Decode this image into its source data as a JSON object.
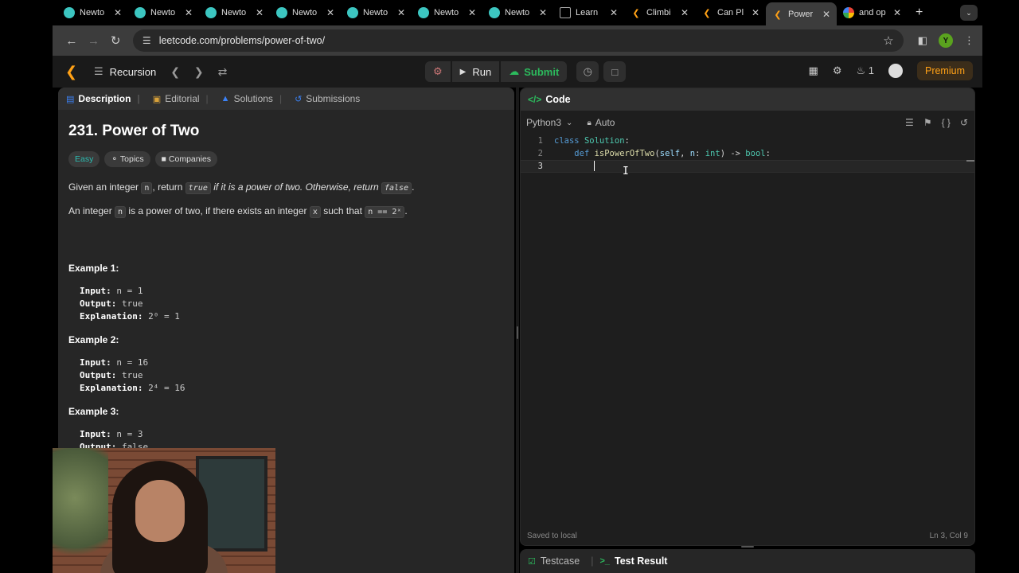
{
  "browser": {
    "tabs": [
      {
        "label": "Newto",
        "fav": "newton"
      },
      {
        "label": "Newto",
        "fav": "newton"
      },
      {
        "label": "Newto",
        "fav": "newton"
      },
      {
        "label": "Newto",
        "fav": "newton"
      },
      {
        "label": "Newto",
        "fav": "newton"
      },
      {
        "label": "Newto",
        "fav": "newton"
      },
      {
        "label": "Newto",
        "fav": "newton"
      },
      {
        "label": "Learn",
        "fav": "doc"
      },
      {
        "label": "Climbi",
        "fav": "leetcode"
      },
      {
        "label": "Can Pl",
        "fav": "leetcode"
      },
      {
        "label": "Power",
        "fav": "leetcode",
        "active": true
      },
      {
        "label": "and op",
        "fav": "google"
      }
    ],
    "url": "leetcode.com/problems/power-of-two/",
    "profile_initial": "Y"
  },
  "nav": {
    "list_label": "Recursion",
    "run_label": "Run",
    "submit_label": "Submit",
    "streak_count": "1",
    "premium_label": "Premium"
  },
  "problem": {
    "tabs": [
      "Description",
      "Editorial",
      "Solutions",
      "Submissions"
    ],
    "title": "231. Power of Two",
    "tags": [
      "Easy",
      "Topics",
      "Companies"
    ],
    "desc1": {
      "p1": "Given an integer ",
      "c1": "n",
      "p2": ", return ",
      "c2": "true",
      "p3": " if it is a power of two. Otherwise, return ",
      "c3": "false",
      "p4": "."
    },
    "desc2": {
      "p1": "An integer ",
      "c1": "n",
      "p2": " is a power of two, if there exists an integer ",
      "c2": "x",
      "p3": " such that ",
      "c3": "n == 2ˣ",
      "p4": "."
    },
    "examples": [
      {
        "title": "Example 1:",
        "input": "n = 1",
        "output": "true",
        "explanation": "2⁰ = 1"
      },
      {
        "title": "Example 2:",
        "input": "n = 16",
        "output": "true",
        "explanation": "2⁴ = 16"
      },
      {
        "title": "Example 3:",
        "input": "n = 3",
        "output": "false"
      }
    ],
    "labels": {
      "input": "Input:",
      "output": "Output:",
      "explanation": "Explanation:"
    }
  },
  "editor": {
    "header": "Code",
    "language": "Python3",
    "mode": "Auto",
    "lines": [
      "1",
      "2",
      "3"
    ],
    "status_left": "Saved to local",
    "status_right": "Ln 3, Col 9"
  },
  "bottom": {
    "testcase_label": "Testcase",
    "result_label": "Test Result"
  },
  "colors": {
    "accent_orange": "#ffa116",
    "green": "#2cbb5d",
    "easy": "#2cbbb0"
  }
}
